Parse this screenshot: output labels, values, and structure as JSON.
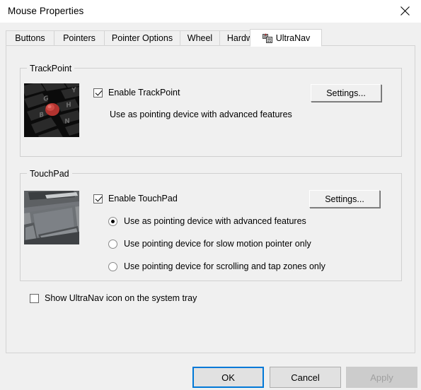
{
  "window": {
    "title": "Mouse Properties",
    "close_icon": "close-icon"
  },
  "tabs": [
    {
      "label": "Buttons",
      "active": false,
      "icon": null
    },
    {
      "label": "Pointers",
      "active": false,
      "icon": null
    },
    {
      "label": "Pointer Options",
      "active": false,
      "icon": null
    },
    {
      "label": "Wheel",
      "active": false,
      "icon": null
    },
    {
      "label": "Hardware",
      "active": false,
      "icon": null
    },
    {
      "label": "UltraNav",
      "active": true,
      "icon": "ultranav-device-icon"
    }
  ],
  "trackpoint": {
    "group_title": "TrackPoint",
    "image_alt": "thinkpad-keyboard-trackpoint-photo",
    "enable_label": "Enable TrackPoint",
    "enable_checked": true,
    "description": "Use as pointing device with advanced features",
    "settings_label": "Settings..."
  },
  "touchpad": {
    "group_title": "TouchPad",
    "image_alt": "laptop-touchpad-photo",
    "enable_label": "Enable TouchPad",
    "enable_checked": true,
    "settings_label": "Settings...",
    "options": [
      {
        "label": "Use as pointing device with advanced features",
        "selected": true
      },
      {
        "label": "Use pointing device for slow motion pointer only",
        "selected": false
      },
      {
        "label": "Use pointing device for scrolling and tap zones only",
        "selected": false
      }
    ]
  },
  "tray": {
    "label": "Show UltraNav icon on the system tray",
    "checked": false
  },
  "dialog_buttons": {
    "ok": "OK",
    "cancel": "Cancel",
    "apply": "Apply",
    "apply_disabled": true
  },
  "colors": {
    "dialog_background": "#f0f0f0",
    "titlebar_background": "#ffffff",
    "active_tab_background": "#ffffff",
    "focus_border": "#0078d7",
    "trackpoint_red": "#c0392b",
    "disabled_text": "#a0a0a0"
  }
}
